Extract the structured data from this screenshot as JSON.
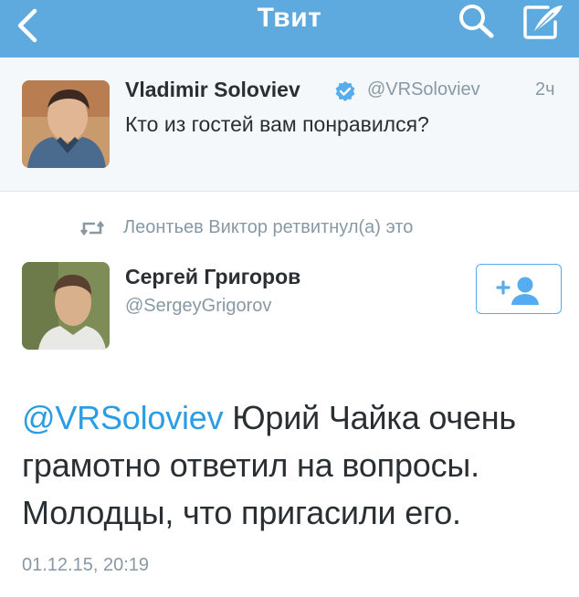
{
  "navbar": {
    "title": "Твит",
    "background": "#5ea9dd",
    "icons": [
      "chevron-left-icon",
      "search-icon",
      "compose-icon"
    ]
  },
  "reply_tweet": {
    "author_name": "Vladimir Soloviev",
    "verified": true,
    "handle": "@VRSoloviev",
    "time": "2ч",
    "text": "Кто из гостей вам понравился?"
  },
  "retweet_context": {
    "icon": "retweet-icon",
    "text": "Леонтьев Виктор ретвитнул(а) это"
  },
  "main_tweet": {
    "author_name": "Сергей Григоров",
    "handle": "@SergeyGrigorov",
    "follow_icon": "add-user-icon",
    "mention": "@VRSoloviev",
    "text_line1_rest": " Юрий Чайка очень",
    "text_line2": "грамотно ответил на вопросы.",
    "text_line3": "Молодцы, что пригасили его.",
    "date": "01.12.15, 20:19"
  },
  "colors": {
    "accent": "#55acee",
    "link": "#2b9de4",
    "secondary_text": "#8899a6",
    "primary_text": "#292f33",
    "panel_bg": "#f5f8fa"
  }
}
